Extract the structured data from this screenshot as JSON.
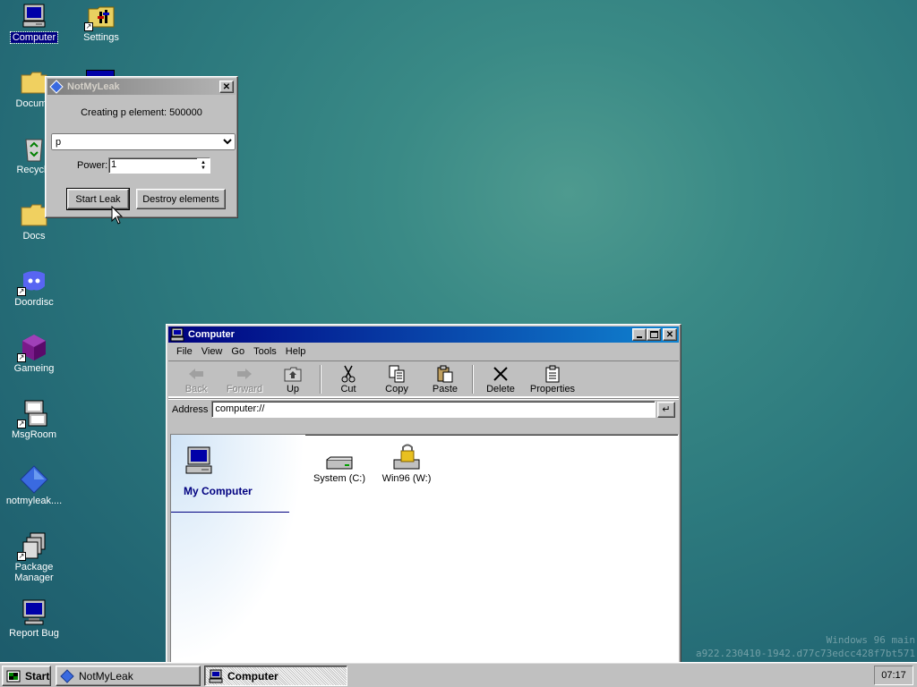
{
  "desktop": {
    "icons": [
      {
        "label": "Computer",
        "icon": "computer-icon"
      },
      {
        "label": "Settings",
        "icon": "settings-icon"
      },
      {
        "label": "Docume",
        "icon": "folder-icon"
      },
      {
        "label": "Recycle",
        "icon": "recycle-bin-icon"
      },
      {
        "label": "Docs",
        "icon": "folder-icon"
      },
      {
        "label": "Doordisc",
        "icon": "doordisc-icon"
      },
      {
        "label": "Gameing",
        "icon": "cube-icon"
      },
      {
        "label": "MsgRoom",
        "icon": "msgroom-icon"
      },
      {
        "label": "notmyleak....",
        "icon": "diamond-icon"
      },
      {
        "label": "Package Manager",
        "icon": "package-icon"
      },
      {
        "label": "Report Bug",
        "icon": "monitor-icon"
      }
    ]
  },
  "leak_window": {
    "title": "NotMyLeak",
    "status": "Creating p element: 500000",
    "element_select": {
      "value": "p",
      "options": [
        "p"
      ]
    },
    "power_label": "Power:",
    "power_value": "1",
    "start_button": "Start Leak",
    "destroy_button": "Destroy elements",
    "close_label": "✕"
  },
  "computer_window": {
    "title": "Computer",
    "menu": [
      "File",
      "View",
      "Go",
      "Tools",
      "Help"
    ],
    "toolbar": [
      {
        "label": "Back",
        "icon": "back-arrow-icon",
        "enabled": false
      },
      {
        "label": "Forward",
        "icon": "forward-arrow-icon",
        "enabled": false
      },
      {
        "label": "Up",
        "icon": "up-folder-icon",
        "enabled": true
      },
      {
        "label": "Cut",
        "icon": "scissors-icon",
        "enabled": true
      },
      {
        "label": "Copy",
        "icon": "copy-icon",
        "enabled": true
      },
      {
        "label": "Paste",
        "icon": "paste-icon",
        "enabled": true
      },
      {
        "label": "Delete",
        "icon": "delete-icon",
        "enabled": true
      },
      {
        "label": "Properties",
        "icon": "properties-icon",
        "enabled": true
      }
    ],
    "address_label": "Address",
    "address_value": "computer://",
    "go_label": "↵",
    "sidebar_title": "My Computer",
    "drives": [
      {
        "label": "System (C:)",
        "icon": "hard-drive-icon"
      },
      {
        "label": "Win96 (W:)",
        "icon": "locked-drive-icon"
      }
    ]
  },
  "taskbar": {
    "start_label": "Start",
    "tasks": [
      {
        "label": "NotMyLeak",
        "active": false
      },
      {
        "label": "Computer",
        "active": true
      }
    ],
    "clock": "07:17"
  },
  "watermark": {
    "line1": "Windows 96 main",
    "line2": "a922.230410-1942.d77c73edcc428f7bt571"
  },
  "colors": {
    "title_active": "#000080",
    "desktop": "#2d7a7e",
    "window_face": "#c0c0c0"
  }
}
